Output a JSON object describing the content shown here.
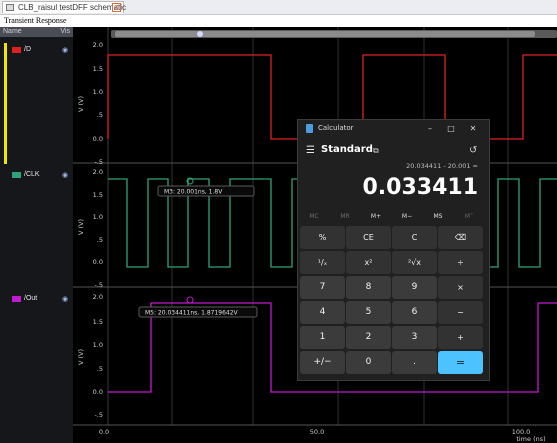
{
  "tab": {
    "label": "CLB_raisul testDFF schematic",
    "close": "x"
  },
  "window": {
    "title": "Transient Response"
  },
  "sidebar": {
    "header_name": "Name",
    "header_vis": "Vis",
    "signals": [
      {
        "label": "/D",
        "color": "#e02020"
      },
      {
        "label": "/CLK",
        "color": "#2ea37a"
      },
      {
        "label": "/Out",
        "color": "#c21ad1"
      }
    ]
  },
  "plot": {
    "y_axis_label": "V (V)",
    "y_ticks": [
      "2.0",
      "1.5",
      "1.0",
      ".5",
      "0.0",
      "-.5"
    ],
    "x_ticks": [
      "0.0",
      "50.0",
      "100.0"
    ],
    "x_axis_label": "time (ns)",
    "markers": {
      "m3": "M3: 20.001ns, 1.8V",
      "m5": "M5: 20.034411ns, 1.8719642V"
    }
  },
  "calculator": {
    "title": "Calculator",
    "mode": "Standard",
    "expression": "20.034411 - 20.001 =",
    "display": "0.033411",
    "memory": [
      "MC",
      "MR",
      "M+",
      "M−",
      "MS",
      "M˅"
    ],
    "keys": [
      [
        "%",
        "CE",
        "C",
        "⌫"
      ],
      [
        "¹/ₓ",
        "x²",
        "²√x",
        "÷"
      ],
      [
        "7",
        "8",
        "9",
        "×"
      ],
      [
        "4",
        "5",
        "6",
        "−"
      ],
      [
        "1",
        "2",
        "3",
        "+"
      ],
      [
        "+/−",
        "0",
        ".",
        "="
      ]
    ]
  },
  "colors": {
    "accent": "#4cc2ff",
    "d_signal": "#e02020",
    "clk_signal": "#2ea37a",
    "out_signal": "#c21ad1"
  }
}
